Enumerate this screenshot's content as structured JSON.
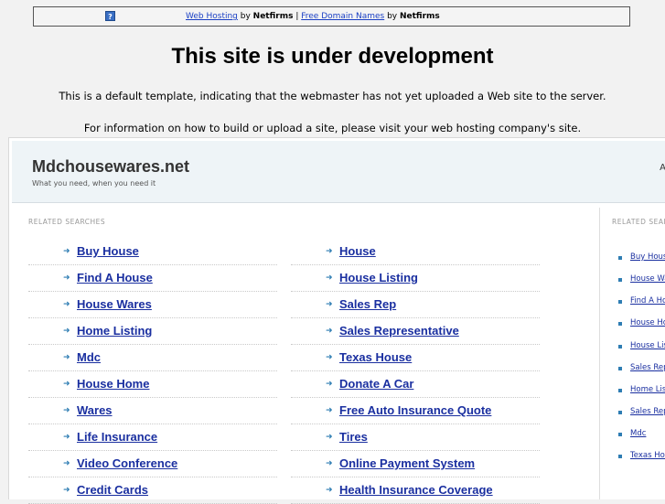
{
  "topbar": {
    "icon": "question-icon",
    "link1": "Web Hosting",
    "by1": " by ",
    "brand1": "Netfirms",
    "sep": " | ",
    "link2": "Free Domain Names",
    "by2": " by ",
    "brand2": "Netfirms"
  },
  "heading": "This site is under development",
  "info1": "This is a default template, indicating that the webmaster has not yet uploaded a Web site to the server.",
  "info2": "For information on how to build or upload a site, please visit your web hosting company's site.",
  "panel": {
    "site_name": "Mdchousewares.net",
    "tagline": "What you need, when you need it",
    "header_cut": "A",
    "related_label": "RELATED SEARCHES",
    "left_items": [
      "Buy House",
      "Find A House",
      "House Wares",
      "Home Listing",
      "Mdc",
      "House Home",
      "Wares",
      "Life Insurance",
      "Video Conference",
      "Credit Cards"
    ],
    "right_items": [
      "House",
      "House Listing",
      "Sales Rep",
      "Sales Representative",
      "Texas House",
      "Donate A Car",
      "Free Auto Insurance Quote",
      "Tires",
      "Online Payment System",
      "Health Insurance Coverage"
    ],
    "side_label": "RELATED SEARCHES",
    "side_items": [
      "Buy House",
      "House Wares",
      "Find A House",
      "House Home",
      "House Listing",
      "Sales Rep",
      "Home Listing",
      "Sales Representative",
      "Mdc",
      "Texas House"
    ]
  },
  "colors": {
    "link": "#1a2fa0",
    "arrow": "#2e7db3",
    "header_bg": "#eef4f7",
    "page_bg": "#f2f2f2"
  }
}
